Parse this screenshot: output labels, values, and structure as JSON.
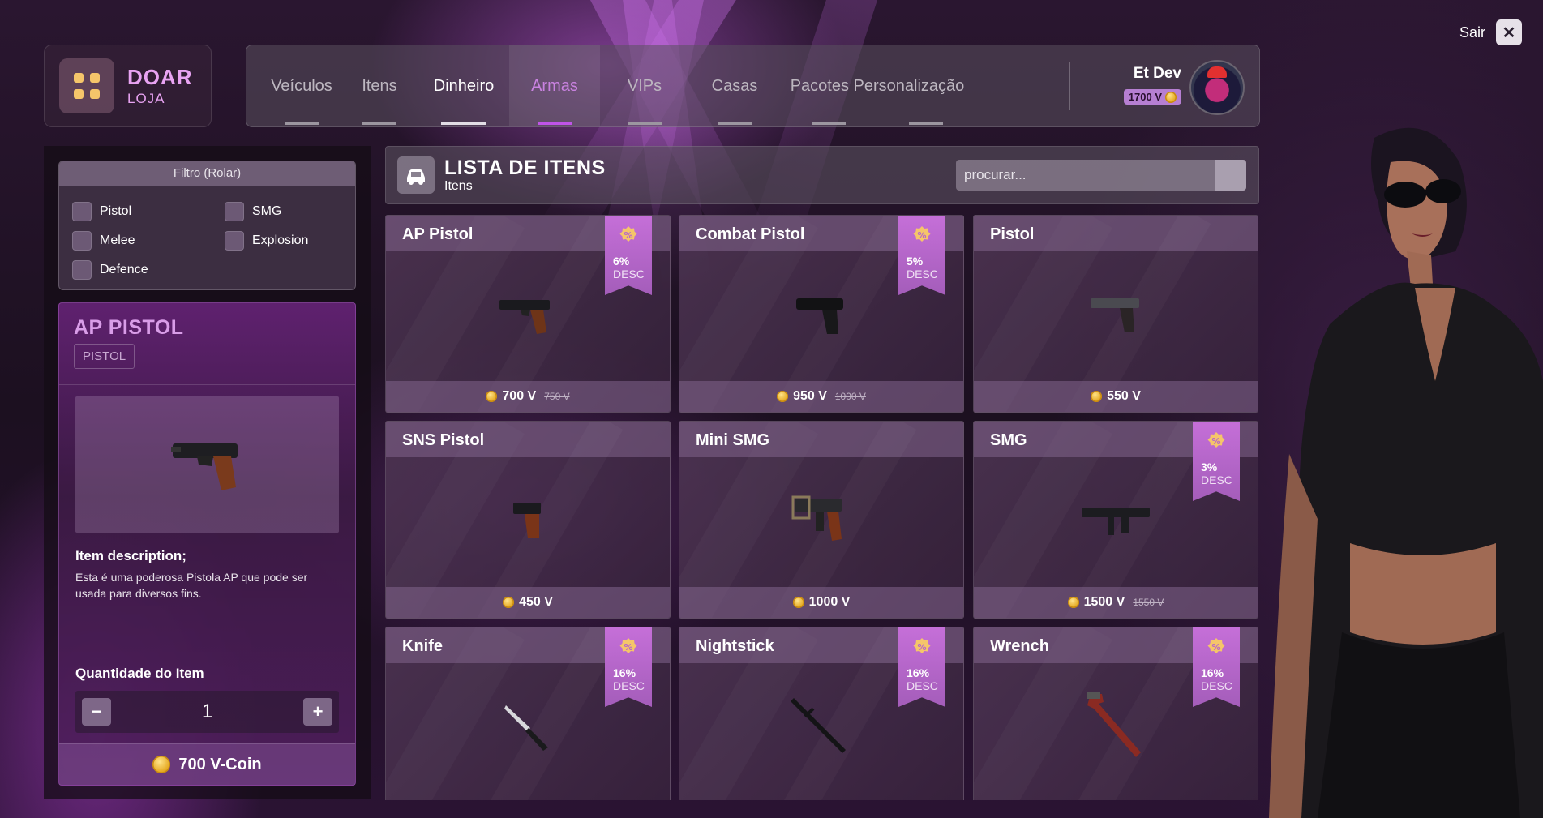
{
  "brand": {
    "title": "DOAR",
    "subtitle": "LOJA"
  },
  "nav": {
    "tabs": [
      {
        "label": "Veículos"
      },
      {
        "label": "Itens"
      },
      {
        "label": "Dinheiro"
      },
      {
        "label": "Armas"
      },
      {
        "label": "VIPs"
      },
      {
        "label": "Casas"
      },
      {
        "label": "Pacotes Personalização"
      }
    ],
    "active_tab": "Armas"
  },
  "user": {
    "name": "Et Dev",
    "coins": "1700 V"
  },
  "exit": {
    "label": "Sair",
    "close_symbol": "✕"
  },
  "filter": {
    "title": "Filtro (Rolar)",
    "options": [
      "Pistol",
      "SMG",
      "Melee",
      "Explosion",
      "Defence"
    ]
  },
  "selected_item": {
    "name": "AP PISTOL",
    "category": "PISTOL",
    "description_title": "Item description;",
    "description": "Esta é uma poderosa Pistola AP que pode ser usada para diversos fins.",
    "quantity_label": "Quantidade do Item",
    "quantity": "1",
    "minus": "−",
    "plus": "+",
    "total": "700 V-Coin"
  },
  "list": {
    "title": "LISTA DE ITENS",
    "subtitle": "Itens",
    "search_placeholder": "procurar..."
  },
  "items": [
    {
      "name": "AP Pistol",
      "price": "700 V",
      "old_price": "750 V",
      "discount": "6%",
      "discount_label": "DESC",
      "icon": "ap-pistol-icon"
    },
    {
      "name": "Combat Pistol",
      "price": "950 V",
      "old_price": "1000 V",
      "discount": "5%",
      "discount_label": "DESC",
      "icon": "combat-pistol-icon"
    },
    {
      "name": "Pistol",
      "price": "550 V",
      "old_price": "",
      "discount": "",
      "discount_label": "",
      "icon": "pistol-icon"
    },
    {
      "name": "SNS Pistol",
      "price": "450 V",
      "old_price": "",
      "discount": "",
      "discount_label": "",
      "icon": "sns-pistol-icon"
    },
    {
      "name": "Mini SMG",
      "price": "1000 V",
      "old_price": "",
      "discount": "",
      "discount_label": "",
      "icon": "mini-smg-icon"
    },
    {
      "name": "SMG",
      "price": "1500 V",
      "old_price": "1550 V",
      "discount": "3%",
      "discount_label": "DESC",
      "icon": "smg-icon"
    },
    {
      "name": "Knife",
      "price": "",
      "old_price": "",
      "discount": "16%",
      "discount_label": "DESC",
      "icon": "knife-icon"
    },
    {
      "name": "Nightstick",
      "price": "",
      "old_price": "",
      "discount": "16%",
      "discount_label": "DESC",
      "icon": "nightstick-icon"
    },
    {
      "name": "Wrench",
      "price": "",
      "old_price": "",
      "discount": "16%",
      "discount_label": "DESC",
      "icon": "wrench-icon"
    }
  ],
  "colors": {
    "accent": "#c054e8",
    "ribbon": "#b566cb",
    "coin": "#f2b92d"
  }
}
